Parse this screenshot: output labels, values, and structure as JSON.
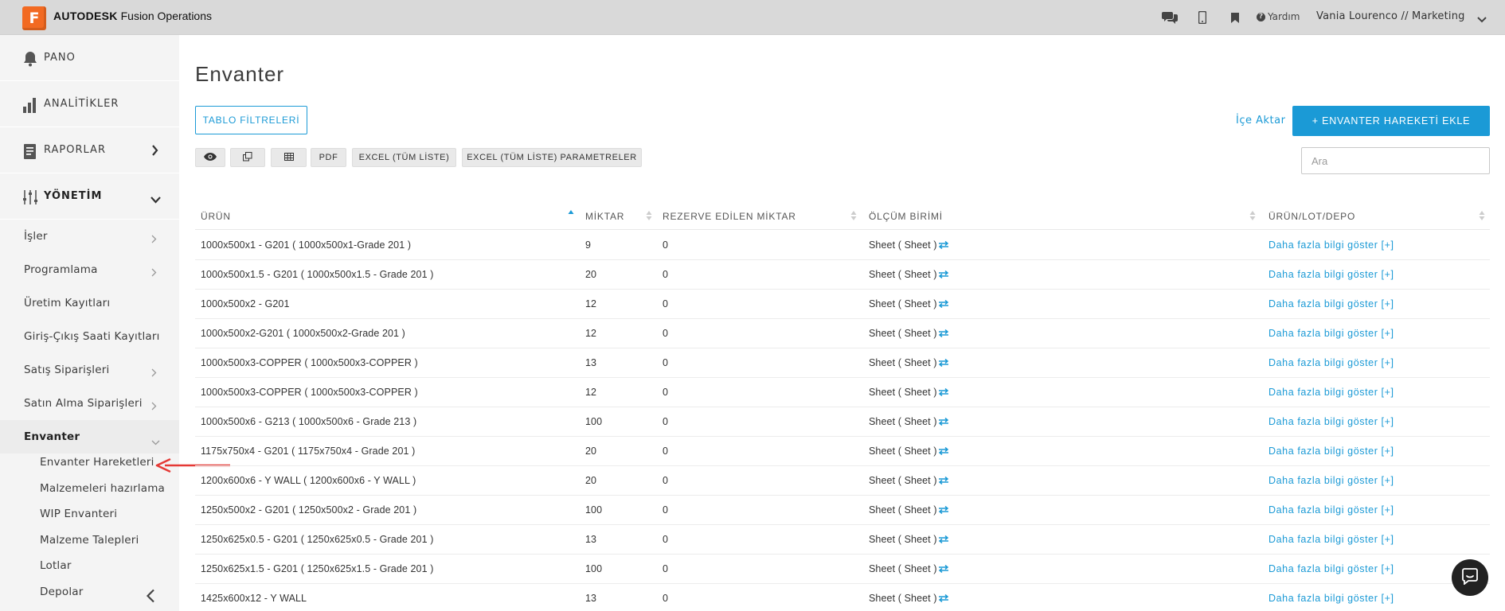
{
  "app": {
    "logo_letter": "F",
    "brand_bold": "AUTODESK",
    "brand_rest": "Fusion Operations",
    "help_label": "Yardım",
    "user_label": "Vania Lourenco // Marketing"
  },
  "sidebar": {
    "main_items": [
      {
        "label": "PANO",
        "icon": "bell-icon"
      },
      {
        "label": "ANALİTİKLER",
        "icon": "bar-chart-icon"
      },
      {
        "label": "RAPORLAR",
        "icon": "report-icon"
      },
      {
        "label": "YÖNETİM",
        "icon": "sliders-icon"
      }
    ],
    "sub_items": [
      {
        "label": "İşler"
      },
      {
        "label": "Programlama"
      },
      {
        "label": "Üretim Kayıtları"
      },
      {
        "label": "Giriş-Çıkış Saati Kayıtları"
      },
      {
        "label": "Satış Siparişleri"
      },
      {
        "label": "Satın Alma Siparişleri"
      },
      {
        "label": "Envanter"
      }
    ],
    "leaf_items": [
      {
        "label": "Envanter Hareketleri"
      },
      {
        "label": "Malzemeleri hazırlama"
      },
      {
        "label": "WIP Envanteri"
      },
      {
        "label": "Malzeme Talepleri"
      },
      {
        "label": "Lotlar"
      },
      {
        "label": "Depolar"
      }
    ]
  },
  "main": {
    "title": "Envanter",
    "filter_button": "TABLO FİLTRELERİ",
    "import_link": "İçe Aktar",
    "add_button": "+ ENVANTER HAREKETİ EKLE",
    "toolbar": {
      "pdf": "PDF",
      "excel_all": "EXCEL (TÜM LİSTE)",
      "excel_params": "EXCEL (TÜM LİSTE) PARAMETRELER"
    },
    "search_placeholder": "Ara"
  },
  "table": {
    "columns": [
      "ÜRÜN",
      "MİKTAR",
      "REZERVE EDİLEN MİKTAR",
      "ÖLÇÜM BİRİMİ",
      "ÜRÜN/LOT/DEPO"
    ],
    "more_link": "Daha fazla bilgi göster [+]",
    "rows": [
      {
        "product": "1000x500x1 - G201 ( 1000x500x1-Grade 201 )",
        "qty": "9",
        "reserved": "0",
        "unit": "Sheet ( Sheet )"
      },
      {
        "product": "1000x500x1.5 - G201 ( 1000x500x1.5 - Grade 201 )",
        "qty": "20",
        "reserved": "0",
        "unit": "Sheet ( Sheet )"
      },
      {
        "product": "1000x500x2 - G201",
        "qty": "12",
        "reserved": "0",
        "unit": "Sheet ( Sheet )"
      },
      {
        "product": "1000x500x2-G201 ( 1000x500x2-Grade 201 )",
        "qty": "12",
        "reserved": "0",
        "unit": "Sheet ( Sheet )"
      },
      {
        "product": "1000x500x3-COPPER ( 1000x500x3-COPPER )",
        "qty": "13",
        "reserved": "0",
        "unit": "Sheet ( Sheet )"
      },
      {
        "product": "1000x500x3-COPPER ( 1000x500x3-COPPER )",
        "qty": "12",
        "reserved": "0",
        "unit": "Sheet ( Sheet )"
      },
      {
        "product": "1000x500x6 - G213 ( 1000x500x6 - Grade 213 )",
        "qty": "100",
        "reserved": "0",
        "unit": "Sheet ( Sheet )"
      },
      {
        "product": "1175x750x4 - G201 ( 1175x750x4 - Grade 201 )",
        "qty": "20",
        "reserved": "0",
        "unit": "Sheet ( Sheet )"
      },
      {
        "product": "1200x600x6 - Y WALL ( 1200x600x6 - Y WALL )",
        "qty": "20",
        "reserved": "0",
        "unit": "Sheet ( Sheet )"
      },
      {
        "product": "1250x500x2 - G201 ( 1250x500x2 - Grade 201 )",
        "qty": "100",
        "reserved": "0",
        "unit": "Sheet ( Sheet )"
      },
      {
        "product": "1250x625x0.5 - G201 ( 1250x625x0.5 - Grade 201 )",
        "qty": "13",
        "reserved": "0",
        "unit": "Sheet ( Sheet )"
      },
      {
        "product": "1250x625x1.5 - G201 ( 1250x625x1.5 - Grade 201 )",
        "qty": "100",
        "reserved": "0",
        "unit": "Sheet ( Sheet )"
      },
      {
        "product": "1425x600x12 - Y WALL",
        "qty": "13",
        "reserved": "0",
        "unit": "Sheet ( Sheet )"
      }
    ]
  },
  "colors": {
    "accent": "#1b9ad6",
    "logo": "#f26a22",
    "topbar": "#d9d9d9",
    "sidebar": "#f4f4f4",
    "annotation": "#e53935"
  }
}
